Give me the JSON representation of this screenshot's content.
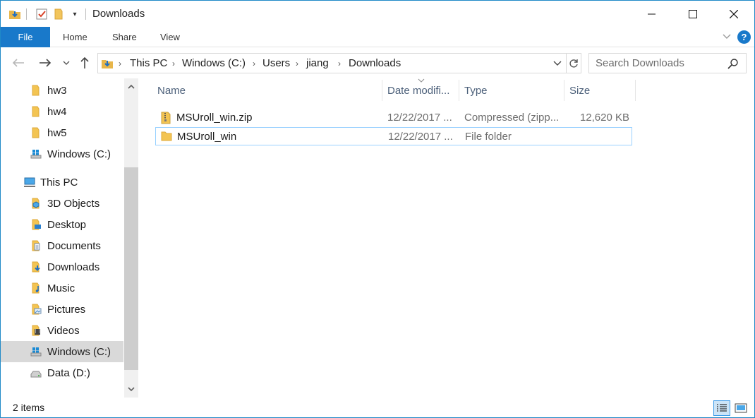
{
  "window": {
    "title": "Downloads",
    "accent": "#1979ca",
    "controls": {
      "minimize": "minimize-icon",
      "maximize": "maximize-icon",
      "close": "close-icon"
    }
  },
  "ribbon": {
    "file_tab": "File",
    "tabs": [
      "Home",
      "Share",
      "View"
    ],
    "help": "?"
  },
  "address": {
    "crumbs": [
      "This PC",
      "Windows (C:)",
      "Users",
      "jiang",
      "Downloads"
    ]
  },
  "search": {
    "placeholder": "Search Downloads"
  },
  "nav_pane": {
    "items": [
      {
        "label": "hw3",
        "icon": "folder-icon"
      },
      {
        "label": "hw4",
        "icon": "folder-icon"
      },
      {
        "label": "hw5",
        "icon": "folder-icon"
      },
      {
        "label": "Windows (C:)",
        "icon": "drive-icon"
      },
      {
        "label": "This PC",
        "icon": "computer-icon"
      },
      {
        "label": "3D Objects",
        "icon": "3d-objects-icon"
      },
      {
        "label": "Desktop",
        "icon": "desktop-icon"
      },
      {
        "label": "Documents",
        "icon": "documents-icon"
      },
      {
        "label": "Downloads",
        "icon": "downloads-icon"
      },
      {
        "label": "Music",
        "icon": "music-icon"
      },
      {
        "label": "Pictures",
        "icon": "pictures-icon"
      },
      {
        "label": "Videos",
        "icon": "videos-icon"
      },
      {
        "label": "Windows (C:)",
        "icon": "drive-icon"
      },
      {
        "label": "Data (D:)",
        "icon": "drive-icon"
      }
    ],
    "selected": "Windows (C:)"
  },
  "columns": {
    "name": "Name",
    "date": "Date modifi...",
    "type": "Type",
    "size": "Size"
  },
  "files": [
    {
      "name": "MSUroll_win.zip",
      "date": "12/22/2017 ...",
      "type": "Compressed (zipp...",
      "size": "12,620 KB",
      "icon": "zip-folder-icon"
    },
    {
      "name": "MSUroll_win",
      "date": "12/22/2017 ...",
      "type": "File folder",
      "size": "",
      "icon": "folder-icon"
    }
  ],
  "status": {
    "count": "2 items"
  }
}
